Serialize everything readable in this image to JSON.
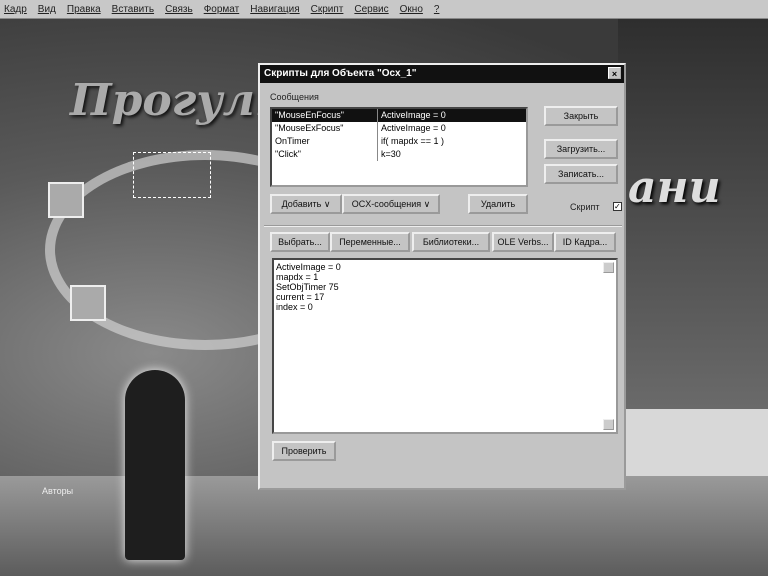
{
  "menu": [
    "Кадр",
    "Вид",
    "Правка",
    "Вставить",
    "Связь",
    "Формат",
    "Навигация",
    "Скрипт",
    "Сервис",
    "Окно",
    "?"
  ],
  "background": {
    "title_left": "Прогулк",
    "title_right": "ани",
    "authors": "Авторы"
  },
  "dialog": {
    "title": "Скрипты для Объекта \"Ocx_1\"",
    "close": "×",
    "messages_label": "Сообщения",
    "messages": [
      {
        "event": "\"MouseEnFocus\"",
        "action": "ActiveImage = 0"
      },
      {
        "event": "\"MouseExFocus\"",
        "action": "ActiveImage = 0"
      },
      {
        "event": "OnTimer",
        "action": "if( mapdx == 1 )"
      },
      {
        "event": "\"Click\"",
        "action": "k=30"
      }
    ],
    "close_button": "Закрыть",
    "load_button": "Загрузить...",
    "save_button": "Записать...",
    "add_button": "Добавить ∨",
    "ocx_button": "OCX-сообщения ∨",
    "delete_button": "Удалить",
    "script_checkbox_label": "Скрипт",
    "script_checked": true,
    "tool_buttons": [
      "Выбрать...",
      "Переменные...",
      "Библиотеки...",
      "OLE Verbs...",
      "ID Кадра..."
    ],
    "code_lines": [
      "ActiveImage = 0",
      "mapdx = 1",
      "SetObjTimer 75",
      "current = 17",
      "index = 0"
    ],
    "check_button": "Проверить"
  }
}
